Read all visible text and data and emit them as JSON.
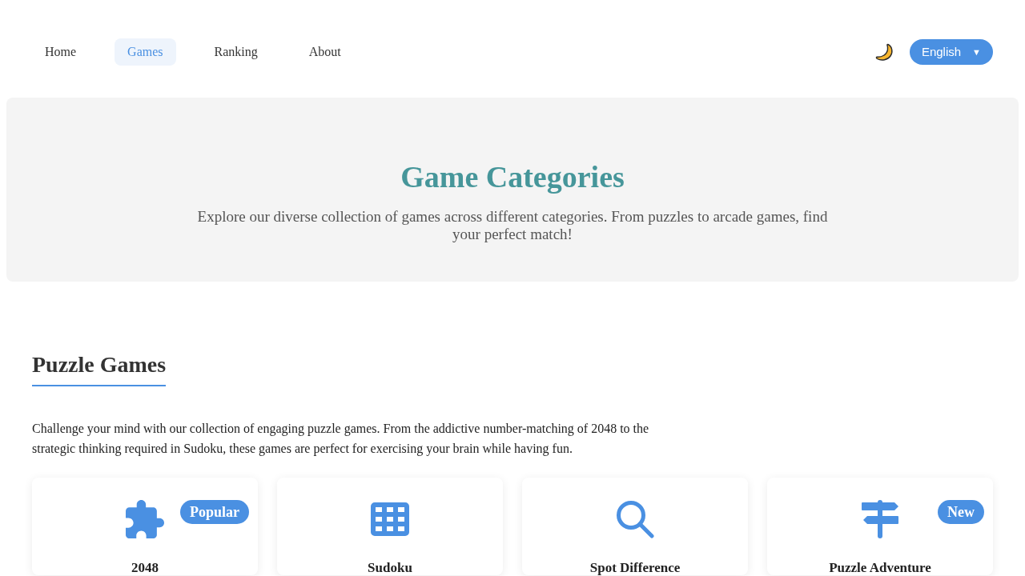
{
  "nav": {
    "items": [
      {
        "label": "Home",
        "selected": false
      },
      {
        "label": "Games",
        "selected": true
      },
      {
        "label": "Ranking",
        "selected": false
      },
      {
        "label": "About",
        "selected": false
      }
    ]
  },
  "language_button": {
    "label": "English",
    "caret": "▼"
  },
  "hero": {
    "title": "Game Categories",
    "description": "Explore our diverse collection of games across different categories. From puzzles to arcade games, find your perfect match!"
  },
  "section": {
    "title": "Puzzle Games",
    "description": "Challenge your mind with our collection of engaging puzzle games. From the addictive number-matching of 2048 to the strategic thinking required in Sudoku, these games are perfect for exercising your brain while having fun.",
    "cards": [
      {
        "title": "2048",
        "badge": "Popular"
      },
      {
        "title": "Sudoku"
      },
      {
        "title": "Spot Difference"
      },
      {
        "title": "Puzzle Adventure",
        "badge": "New"
      }
    ]
  }
}
